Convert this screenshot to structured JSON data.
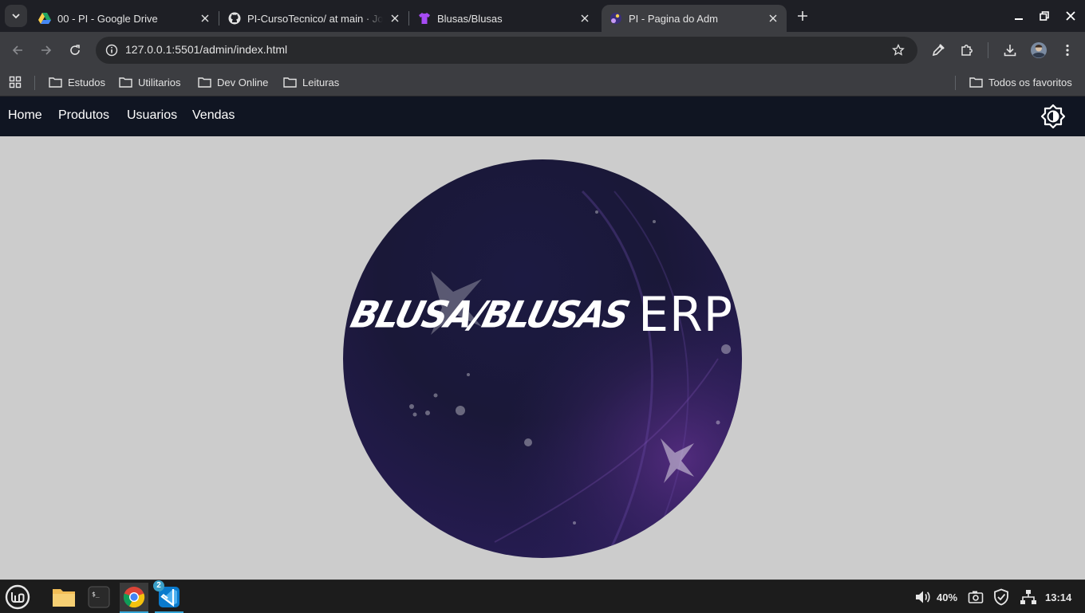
{
  "browser": {
    "tabs": [
      {
        "title": "00 - PI - Google Drive",
        "favicon": "google-drive-icon",
        "active": false
      },
      {
        "title": "PI-CursoTecnico/ at main · JoaoV",
        "favicon": "github-icon",
        "active": false
      },
      {
        "title": "Blusas/Blusas",
        "favicon": "shirt-icon",
        "active": false
      },
      {
        "title": "PI - Pagina do Adm",
        "favicon": "app-logo-icon",
        "active": true
      }
    ],
    "url": "127.0.0.1:5501/admin/index.html",
    "bookmarks": [
      "Estudos",
      "Utilitarios",
      "Dev Online",
      "Leituras"
    ],
    "all_bookmarks_label": "Todos os favoritos"
  },
  "page": {
    "nav": [
      {
        "label": "Home"
      },
      {
        "label": "Produtos"
      },
      {
        "label": "Usuarios"
      },
      {
        "label": "Vendas"
      }
    ],
    "logo": {
      "brand": "BLUSA/BLUSAS",
      "suffix": "ERP"
    }
  },
  "taskbar": {
    "apps": [
      {
        "name": "file-manager",
        "running": false
      },
      {
        "name": "terminal",
        "running": false
      },
      {
        "name": "chrome",
        "running": true
      },
      {
        "name": "vscode",
        "running": true,
        "badge": "2"
      }
    ],
    "volume_percent": "40%",
    "clock": "13:14"
  },
  "colors": {
    "navbar": "#101522",
    "page_bg": "#cccccc",
    "logo_bg": "#1c1a42",
    "tab_strip": "#1e1f25",
    "toolbar": "#3c3d41"
  }
}
